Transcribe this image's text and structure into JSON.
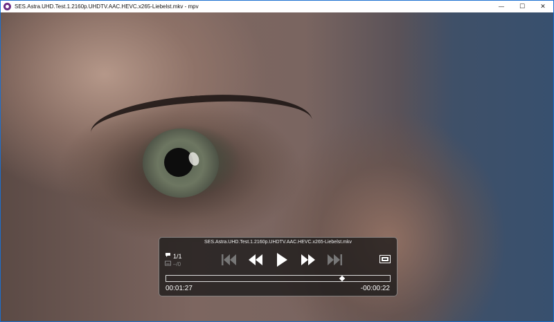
{
  "window": {
    "title": "SES.Astra.UHD.Test.1.2160p.UHDTV.AAC.HEVC.x265-Liebelst.mkv - mpv",
    "minimize_glyph": "—",
    "maximize_glyph": "☐",
    "close_glyph": "✕"
  },
  "osc": {
    "filename": "SES.Astra.UHD.Test.1.2160p.UHDTV.AAC.HEVC.x265-Liebelst.mkv",
    "audio_icon": "speech-bubble-icon",
    "audio_track": "1/1",
    "subtitle_icon": "subtitle-icon",
    "subtitle_track": "–/0",
    "controls": [
      "skip-previous-icon",
      "rewind-icon",
      "play-icon",
      "fast-forward-icon",
      "skip-next-icon"
    ],
    "fullscreen_icon": "fullscreen-icon",
    "position_fraction": 0.786,
    "time_elapsed": "00:01:27",
    "time_remaining": "-00:00:22"
  }
}
